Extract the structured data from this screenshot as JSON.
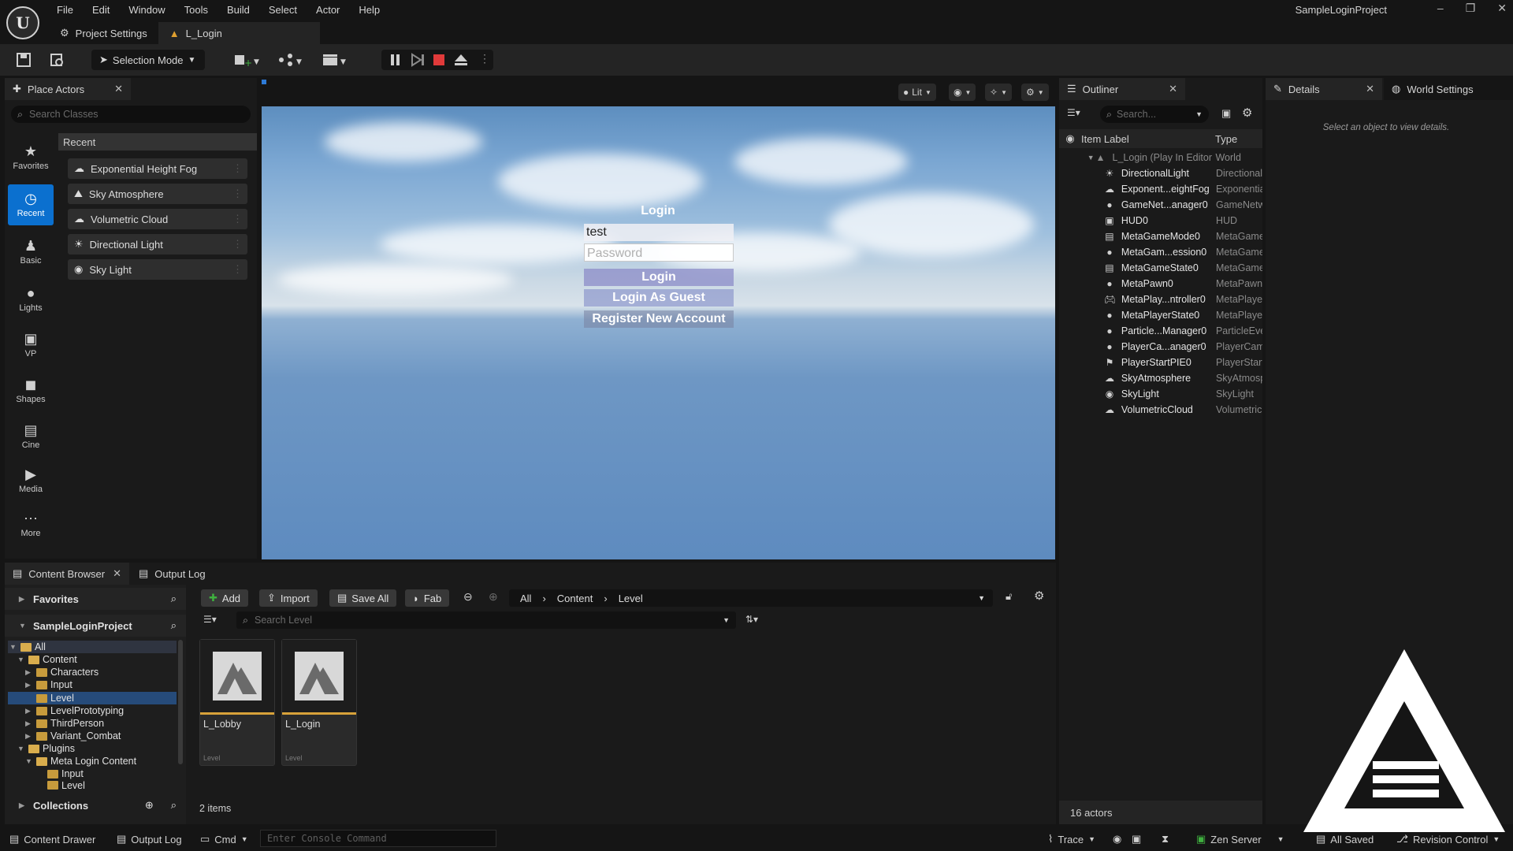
{
  "app": {
    "project_name": "SampleLoginProject",
    "menu": [
      "File",
      "Edit",
      "Window",
      "Tools",
      "Build",
      "Select",
      "Actor",
      "Help"
    ],
    "doc_tabs": [
      {
        "label": "Project Settings",
        "icon": "gear-icon"
      },
      {
        "label": "L_Login",
        "icon": "level-icon"
      }
    ]
  },
  "toolbar": {
    "selection_mode": "Selection Mode"
  },
  "place_actors": {
    "tab_label": "Place Actors",
    "search_placeholder": "Search Classes",
    "categories": [
      "Favorites",
      "Recent",
      "Basic",
      "Lights",
      "VP",
      "Shapes",
      "Cine",
      "Media",
      "More"
    ],
    "recent_header": "Recent",
    "items": [
      "Exponential Height Fog",
      "Sky Atmosphere",
      "Volumetric Cloud",
      "Directional Light",
      "Sky Light"
    ]
  },
  "viewport": {
    "lit_label": "Lit",
    "login": {
      "title": "Login",
      "username_value": "test",
      "password_placeholder": "Password",
      "login_button": "Login",
      "guest_button": "Login As Guest",
      "register_button": "Register New Account"
    }
  },
  "outliner": {
    "tab_label": "Outliner",
    "search_placeholder": "Search...",
    "col_label": "Item Label",
    "col_type": "Type",
    "root": {
      "label": "L_Login (Play In Editor)",
      "type": "World"
    },
    "rows": [
      {
        "label": "DirectionalLight",
        "type": "DirectionalLight"
      },
      {
        "label": "Exponent...eightFog",
        "type": "ExponentialHeightFog"
      },
      {
        "label": "GameNet...anager0",
        "type": "GameNetworkManager"
      },
      {
        "label": "HUD0",
        "type": "HUD"
      },
      {
        "label": "MetaGameMode0",
        "type": "MetaGameMode"
      },
      {
        "label": "MetaGam...ession0",
        "type": "MetaGameSession"
      },
      {
        "label": "MetaGameState0",
        "type": "MetaGameState"
      },
      {
        "label": "MetaPawn0",
        "type": "MetaPawn"
      },
      {
        "label": "MetaPlay...ntroller0",
        "type": "MetaPlayerController"
      },
      {
        "label": "MetaPlayerState0",
        "type": "MetaPlayerState"
      },
      {
        "label": "Particle...Manager0",
        "type": "ParticleEventManager"
      },
      {
        "label": "PlayerCa...anager0",
        "type": "PlayerCameraManager"
      },
      {
        "label": "PlayerStartPIE0",
        "type": "PlayerStartPIE"
      },
      {
        "label": "SkyAtmosphere",
        "type": "SkyAtmosphere"
      },
      {
        "label": "SkyLight",
        "type": "SkyLight"
      },
      {
        "label": "VolumetricCloud",
        "type": "VolumetricCloud"
      }
    ],
    "footer": "16 actors"
  },
  "details": {
    "tab_label": "Details",
    "world_settings_label": "World Settings",
    "empty_message": "Select an object to view details."
  },
  "content_browser": {
    "tab_label": "Content Browser",
    "output_log_tab": "Output Log",
    "favorites": "Favorites",
    "project": "SampleLoginProject",
    "collections": "Collections",
    "tree": [
      "All",
      "Content",
      "Characters",
      "Input",
      "Level",
      "LevelPrototyping",
      "ThirdPerson",
      "Variant_Combat",
      "Plugins",
      "Meta Login Content",
      "Input",
      "Level"
    ],
    "buttons": {
      "add": "Add",
      "import": "Import",
      "save_all": "Save All",
      "fab": "Fab"
    },
    "path": [
      "All",
      "Content",
      "Level"
    ],
    "search_placeholder": "Search Level",
    "assets": [
      {
        "name": "L_Lobby",
        "kind": "Level"
      },
      {
        "name": "L_Login",
        "kind": "Level"
      }
    ],
    "count": "2 items"
  },
  "statusbar": {
    "content_drawer": "Content Drawer",
    "output_log": "Output Log",
    "cmd": "Cmd",
    "console_placeholder": "Enter Console Command",
    "trace": "Trace",
    "zen_server": "Zen Server",
    "all_saved": "All Saved",
    "revision_control": "Revision Control"
  }
}
